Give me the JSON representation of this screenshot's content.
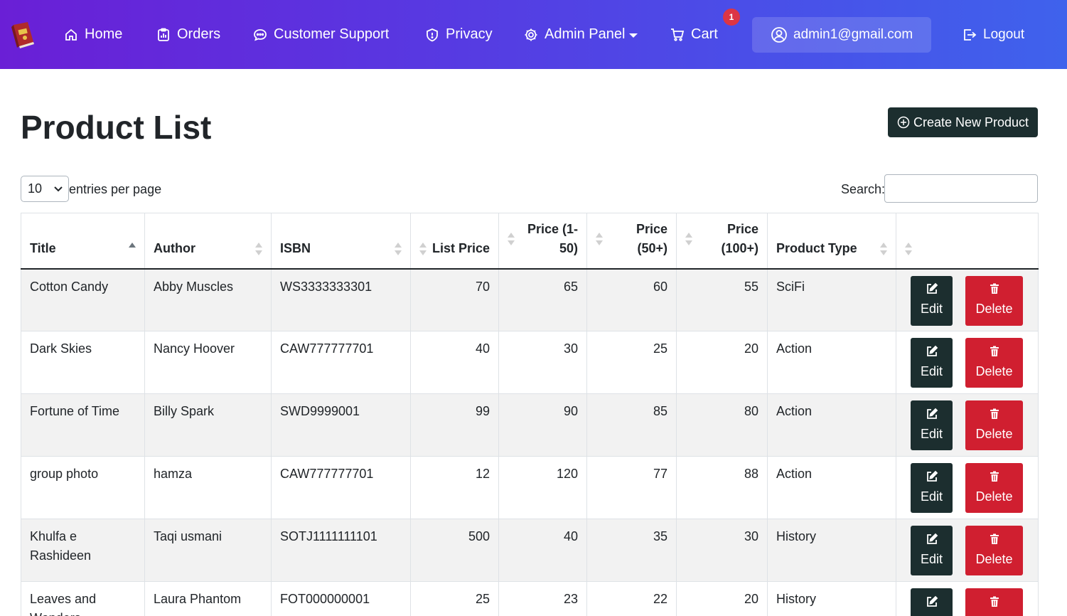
{
  "nav": {
    "home": "Home",
    "orders": "Orders",
    "support": "Customer Support",
    "privacy": "Privacy",
    "admin": "Admin Panel",
    "cart": "Cart",
    "cart_count": "1",
    "user_email": "admin1@gmail.com",
    "logout": "Logout"
  },
  "page": {
    "title": "Product List",
    "create_label": "Create New Product"
  },
  "controls": {
    "entries_value": "10",
    "entries_label": "entries per page",
    "search_label": "Search:",
    "search_value": ""
  },
  "table": {
    "headers": {
      "title": "Title",
      "author": "Author",
      "isbn": "ISBN",
      "list_price": "List Price",
      "price_1_50_a": "Price (1-",
      "price_1_50_b": "50)",
      "price_50_a": "Price",
      "price_50_b": "(50+)",
      "price_100_a": "Price",
      "price_100_b": "(100+)",
      "product_type": "Product Type"
    },
    "edit_label": "Edit",
    "delete_label": "Delete",
    "rows": [
      {
        "title": "Cotton Candy",
        "author": "Abby Muscles",
        "isbn": "WS3333333301",
        "list": "70",
        "p50": "65",
        "p50p": "60",
        "p100": "55",
        "type": "SciFi"
      },
      {
        "title": "Dark Skies",
        "author": "Nancy Hoover",
        "isbn": "CAW777777701",
        "list": "40",
        "p50": "30",
        "p50p": "25",
        "p100": "20",
        "type": "Action"
      },
      {
        "title": "Fortune of Time",
        "author": "Billy Spark",
        "isbn": "SWD9999001",
        "list": "99",
        "p50": "90",
        "p50p": "85",
        "p100": "80",
        "type": "Action"
      },
      {
        "title": "group photo",
        "author": "hamza",
        "isbn": "CAW777777701",
        "list": "12",
        "p50": "120",
        "p50p": "77",
        "p100": "88",
        "type": "Action"
      },
      {
        "title": "Khulfa e Rashideen",
        "author": "Taqi usmani",
        "isbn": "SOTJ1111111101",
        "list": "500",
        "p50": "40",
        "p50p": "35",
        "p100": "30",
        "type": "History"
      },
      {
        "title": "Leaves and Wonders",
        "author": "Laura Phantom",
        "isbn": "FOT000000001",
        "list": "25",
        "p50": "23",
        "p50p": "22",
        "p100": "20",
        "type": "History"
      }
    ]
  },
  "colors": {
    "nav_start": "#6a1fd6",
    "nav_end": "#3f62ec",
    "dark_button": "#1c2e2f",
    "danger": "#d01f30",
    "badge": "#dc3545"
  }
}
